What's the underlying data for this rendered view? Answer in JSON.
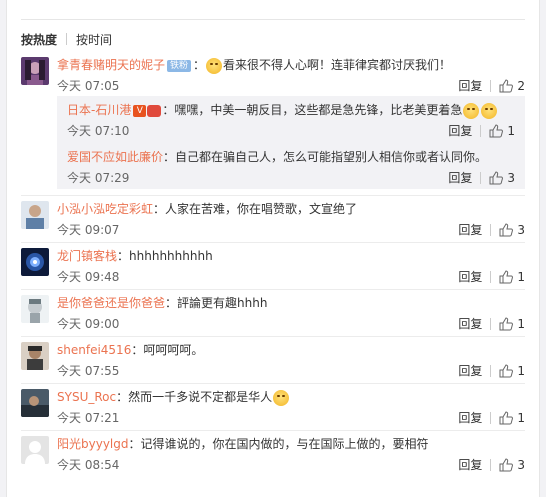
{
  "sort": {
    "hot": "按热度",
    "time": "按时间"
  },
  "comments": [
    {
      "user": "拿青春赌明天的妮子",
      "badge": "铁粉",
      "text": "看来很不得人心啊！连菲律宾都讨厌我们！",
      "time": "今天 07:05",
      "reply": "回复",
      "likes": "2",
      "subs": [
        {
          "user": "日本-石川港",
          "vbadge": "V",
          "text": "：嘿嘿，中美一朝反目，这些都是急先锋，比老美更着急",
          "time": "今天 07:10",
          "reply": "回复",
          "likes": "1"
        },
        {
          "user": "爱国不应如此廉价",
          "text": "：自己都在骗自己人，怎么可能指望别人相信你或者认同你。",
          "time": "今天 07:29",
          "reply": "回复",
          "likes": "3"
        }
      ]
    },
    {
      "user": "小泓小泓吃定彩虹",
      "text": "：人家在苦难，你在唱赞歌，文宣绝了",
      "time": "今天 09:07",
      "reply": "回复",
      "likes": "3"
    },
    {
      "user": "龙门镇客栈",
      "text": "：hhhhhhhhhhh",
      "time": "今天 09:48",
      "reply": "回复",
      "likes": "1"
    },
    {
      "user": "是你爸爸还是你爸爸",
      "text": "：評論更有趣hhhh",
      "time": "今天 09:00",
      "reply": "回复",
      "likes": "1"
    },
    {
      "user": "shenfei4516",
      "text": "：呵呵呵呵。",
      "time": "今天 07:55",
      "reply": "回复",
      "likes": "1"
    },
    {
      "user": "SYSU_Roc",
      "text": "：然而一千多说不定都是华人",
      "time": "今天 07:21",
      "reply": "回复",
      "likes": "1"
    },
    {
      "user": "阳光byyylgd",
      "text": "：记得谁说的，你在国内做的，与在国际上做的，要相符",
      "time": "今天 08:54",
      "reply": "回复",
      "likes": "3"
    }
  ]
}
